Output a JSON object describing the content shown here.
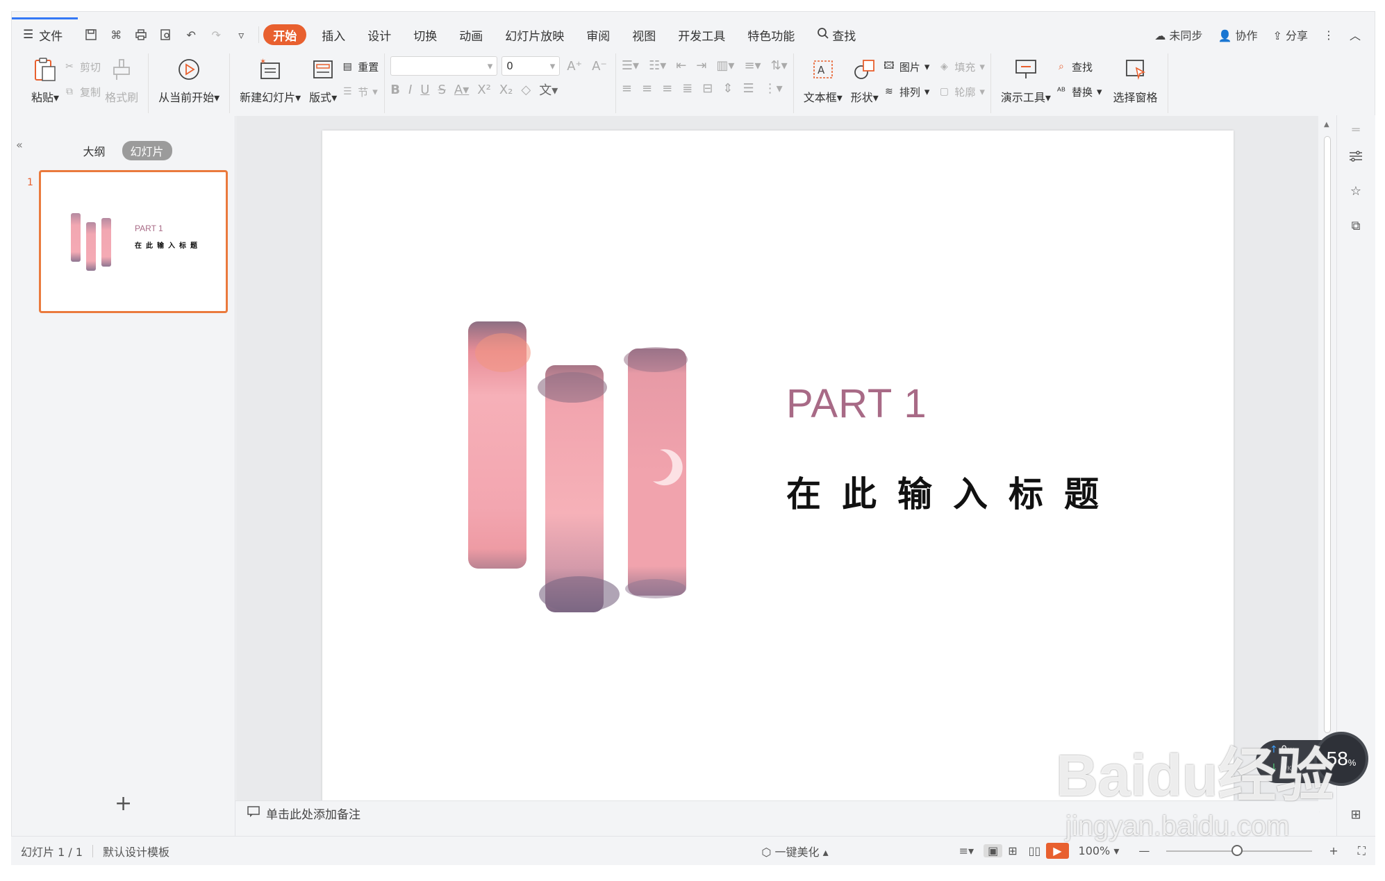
{
  "menu": {
    "file": "文件",
    "tabs": [
      "开始",
      "插入",
      "设计",
      "切换",
      "动画",
      "幻灯片放映",
      "审阅",
      "视图",
      "开发工具",
      "特色功能"
    ],
    "active_tab": "开始",
    "search": "查找",
    "right": {
      "sync": "未同步",
      "collab": "协作",
      "share": "分享"
    }
  },
  "ribbon": {
    "paste": "粘贴",
    "cut": "剪切",
    "copy": "复制",
    "format_painter": "格式刷",
    "from_current": "从当前开始",
    "new_slide": "新建幻灯片",
    "layout": "版式",
    "reset": "重置",
    "section": "节",
    "font_size": "0",
    "text_box": "文本框",
    "shape": "形状",
    "picture": "图片",
    "fill": "填充",
    "arrange": "排列",
    "outline": "轮廓",
    "present_tools": "演示工具",
    "find": "查找",
    "replace": "替换",
    "select_pane": "选择窗格"
  },
  "panel": {
    "tab_outline": "大纲",
    "tab_slides": "幻灯片",
    "slide_number": "1",
    "thumb_part": "PART 1",
    "thumb_title": "在此输入标题"
  },
  "slide": {
    "part": "PART 1",
    "title": "在此输入标题"
  },
  "notes_placeholder": "单击此处添加备注",
  "status": {
    "slide_count": "幻灯片 1 / 1",
    "template": "默认设计模板",
    "beautify": "一键美化",
    "zoom": "100%"
  },
  "speed": {
    "up": "0",
    "down": "0",
    "unit": "K/s",
    "percent": "58",
    "percent_sign": "%"
  },
  "watermark": {
    "logo": "Baidu经验",
    "url": "jingyan.baidu.com"
  },
  "colors": {
    "accent": "#e8602f",
    "slide_pink": "#a86a86",
    "selection": "#ea7a3d"
  }
}
